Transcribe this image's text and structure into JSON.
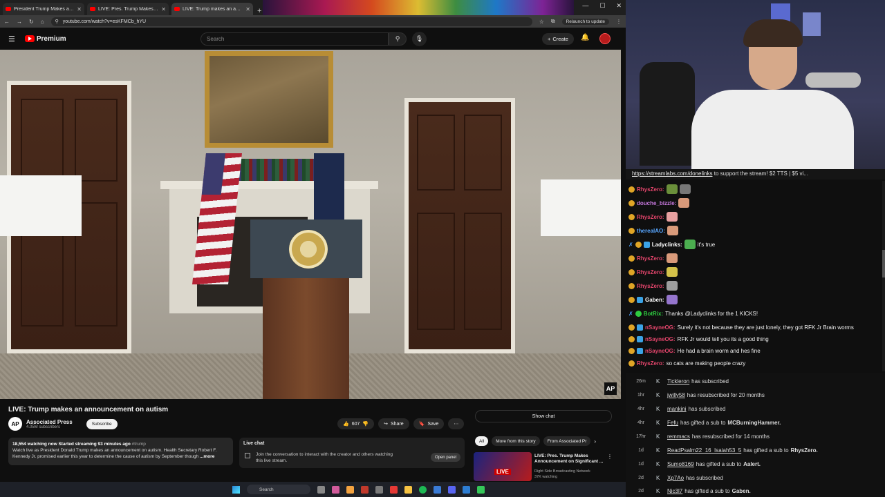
{
  "browser": {
    "tabs": [
      {
        "title": "President Trump Makes an Anno…"
      },
      {
        "title": "LIVE: Pres. Trump Makes Annou…"
      },
      {
        "title": "LIVE: Trump makes an announce…"
      }
    ],
    "url": "youtube.com/watch?v=esKFMCb_hYU",
    "relaunch_label": "Relaunch to update"
  },
  "youtube": {
    "logo_text": "Premium",
    "search_placeholder": "Search",
    "create_label": "Create",
    "video": {
      "title": "LIVE: Trump makes an announcement on autism",
      "watermark": "AP"
    },
    "channel": {
      "avatar_text": "AP",
      "name": "Associated Press",
      "subscribers": "4.05M subscribers",
      "subscribe_label": "Subscribe"
    },
    "actions": {
      "likes": "607",
      "share": "Share",
      "save": "Save"
    },
    "description": {
      "stats": "18,554 watching now  Started streaming 93 minutes ago",
      "hashtag": "#trump",
      "text": "Watch live as President Donald Trump makes an announcement on autism. Health Secretary Robert F. Kennedy Jr. promised earlier this year to determine the cause of autism by September though",
      "more": "...more"
    },
    "live_chat": {
      "title": "Live chat",
      "text": "Join the conversation to interact with the creator and others watching this live stream.",
      "open_panel": "Open panel"
    },
    "sidebar": {
      "show_chat": "Show chat",
      "chips": [
        "All",
        "More from this story",
        "From Associated Pr"
      ],
      "recommended": {
        "badge": "LIVE",
        "title": "LIVE: Pres. Trump Makes Announcement on Significant ...",
        "channel": "Right Side Broadcasting Network",
        "views": "37K watching"
      }
    }
  },
  "taskbar": {
    "search_label": "Search"
  },
  "stream": {
    "ticker": {
      "link": "https://streamlabs.com/donelinks",
      "text": " to support the stream! $2 TTS | $5 vi..."
    },
    "chat": [
      {
        "user": "RhysZero:",
        "color": "#e2456b",
        "text": ""
      },
      {
        "user": "douche_bizzle:",
        "color": "#c678dd",
        "text": ""
      },
      {
        "user": "RhysZero:",
        "color": "#e2456b",
        "text": ""
      },
      {
        "user": "therealAO:",
        "color": "#58a6ff",
        "text": ""
      },
      {
        "user": "Ladyclinks:",
        "color": "#ffffff",
        "text": "it's true"
      },
      {
        "user": "RhysZero:",
        "color": "#e2456b",
        "text": ""
      },
      {
        "user": "RhysZero:",
        "color": "#e2456b",
        "text": ""
      },
      {
        "user": "RhysZero:",
        "color": "#e2456b",
        "text": ""
      },
      {
        "user": "Gaben:",
        "color": "#ffffff",
        "text": ""
      },
      {
        "user": "BotRix:",
        "color": "#2ecc40",
        "text": "Thanks @Ladyclinks for the 1 KICKS!"
      },
      {
        "user": "nSayneOG:",
        "color": "#e2456b",
        "text": "Surely it's not because they are just lonely, they got RFK Jr Brain worms"
      },
      {
        "user": "nSayneOG:",
        "color": "#e2456b",
        "text": "RFK Jr would tell you its a good thing"
      },
      {
        "user": "nSayneOG:",
        "color": "#e2456b",
        "text": "He had a brain worm and hes fine"
      },
      {
        "user": "RhysZero:",
        "color": "#e2456b",
        "text": "so  cats are making people crazy"
      }
    ],
    "events": [
      {
        "time": "26m",
        "name": "Tickleron",
        "action": "has subscribed",
        "target": ""
      },
      {
        "time": "1hr",
        "name": "jwilly58",
        "action": "has resubscribed for 20 months",
        "target": ""
      },
      {
        "time": "4hr",
        "name": "mankini",
        "action": "has subscribed",
        "target": ""
      },
      {
        "time": "4hr",
        "name": "Fefu",
        "action": "has gifted a sub to",
        "target": "MCBurningHammer."
      },
      {
        "time": "17hr",
        "name": "remmacs",
        "action": "has resubscribed for 14 months",
        "target": ""
      },
      {
        "time": "1d",
        "name": "ReadPsalm22_16_Isaiah53_5",
        "action": "has gifted a sub to",
        "target": "RhysZero."
      },
      {
        "time": "1d",
        "name": "Sumo8169",
        "action": "has gifted a sub to",
        "target": "Aalert."
      },
      {
        "time": "2d",
        "name": "Xp7Ao",
        "action": "has subscribed",
        "target": ""
      },
      {
        "time": "2d",
        "name": "Nic3l7",
        "action": "has gifted a sub to",
        "target": "Gaben."
      }
    ]
  }
}
